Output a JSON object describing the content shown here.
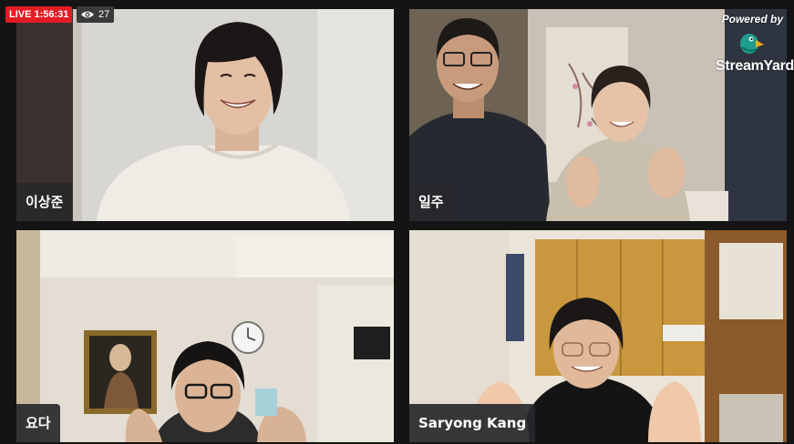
{
  "stream": {
    "live_label": "LIVE 1:56:31",
    "viewer_count": "27",
    "eye_icon": "eye-icon"
  },
  "branding": {
    "powered_by": "Powered by",
    "brand_name": "StreamYard",
    "logo_icon": "streamyard-logo-icon"
  },
  "participants": [
    {
      "name": "이상준"
    },
    {
      "name": "일주"
    },
    {
      "name": "요다"
    },
    {
      "name": "Saryong Kang"
    }
  ],
  "colors": {
    "live_red": "#e31b23",
    "name_tag_bg": "#28282c",
    "background": "#141414"
  }
}
